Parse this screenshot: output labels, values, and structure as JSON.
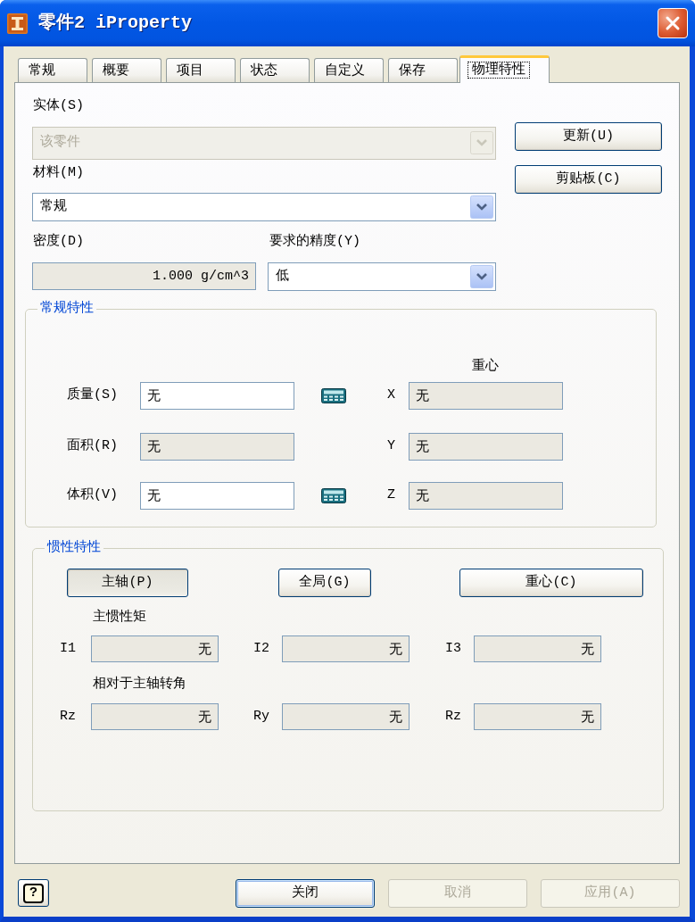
{
  "window": {
    "title": "零件2 iProperty"
  },
  "tabs": [
    {
      "label": "常规",
      "selected": false
    },
    {
      "label": "概要",
      "selected": false
    },
    {
      "label": "项目",
      "selected": false
    },
    {
      "label": "状态",
      "selected": false
    },
    {
      "label": "自定义",
      "selected": false
    },
    {
      "label": "保存",
      "selected": false
    },
    {
      "label": "物理特性",
      "selected": true
    }
  ],
  "body_selector": {
    "label": "实体(S)",
    "value": "该零件",
    "disabled": true
  },
  "update_button": {
    "label": "更新(U)"
  },
  "material": {
    "label": "材料(M)",
    "value": "常规",
    "disabled": false
  },
  "clipboard_button": {
    "label": "剪贴板(C)"
  },
  "density": {
    "label": "密度(D)",
    "value": "1.000 g/cm^3",
    "readonly": true
  },
  "accuracy": {
    "label": "要求的精度(Y)",
    "value": "低",
    "disabled": false
  },
  "general_properties": {
    "title": "常规特性",
    "center_of_gravity_heading": "重心",
    "rows": [
      {
        "label": "质量(S)",
        "value": "无",
        "readonly": false,
        "calculator": true,
        "axis": "X",
        "axis_value": "无"
      },
      {
        "label": "面积(R)",
        "value": "无",
        "readonly": true,
        "calculator": false,
        "axis": "Y",
        "axis_value": "无"
      },
      {
        "label": "体积(V)",
        "value": "无",
        "readonly": false,
        "calculator": true,
        "axis": "Z",
        "axis_value": "无"
      }
    ]
  },
  "inertial_properties": {
    "title": "惯性特性",
    "buttons": [
      {
        "label": "主轴(P)",
        "selected": true
      },
      {
        "label": "全局(G)",
        "selected": false
      },
      {
        "label": "重心(C)",
        "selected": false
      }
    ],
    "moments_heading": "主惯性矩",
    "moments": [
      {
        "label": "I1",
        "value": "无"
      },
      {
        "label": "I2",
        "value": "无"
      },
      {
        "label": "I3",
        "value": "无"
      }
    ],
    "angles_heading": "相对于主轴转角",
    "angles": [
      {
        "label": "Rz",
        "value": "无"
      },
      {
        "label": "Ry",
        "value": "无"
      },
      {
        "label": "Rz",
        "value": "无"
      }
    ]
  },
  "footer": {
    "help_button": {
      "glyph": "?"
    },
    "close_button": {
      "label": "关闭",
      "default": true,
      "disabled": false
    },
    "cancel_button": {
      "label": "取消",
      "disabled": true
    },
    "apply_button": {
      "label": "应用(A)",
      "disabled": true
    }
  }
}
